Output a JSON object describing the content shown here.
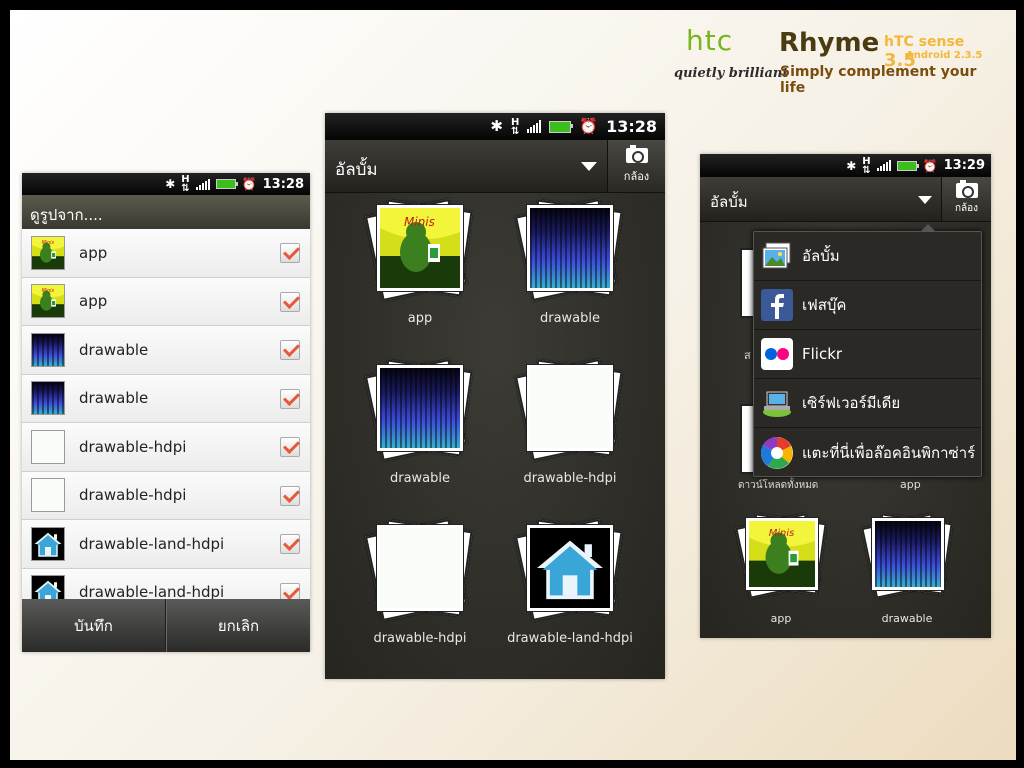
{
  "brand": {
    "logo": "htc",
    "model": "Rhyme",
    "sense": "hTC sense",
    "sense_version": "3.5",
    "android": "Android 2.3.5",
    "tagline1": "quietly brilliant",
    "tagline2": "Simply complement your life"
  },
  "status": {
    "time1": "13:28",
    "time2": "13:28",
    "time3": "13:29",
    "network": "H"
  },
  "phone1": {
    "title": "ดูรูปจาก....",
    "items": [
      {
        "label": "app",
        "art": "app"
      },
      {
        "label": "app",
        "art": "app"
      },
      {
        "label": "drawable",
        "art": "spec"
      },
      {
        "label": "drawable",
        "art": "spec"
      },
      {
        "label": "drawable-hdpi",
        "art": "blank"
      },
      {
        "label": "drawable-hdpi",
        "art": "blank"
      },
      {
        "label": "drawable-land-hdpi",
        "art": "house"
      },
      {
        "label": "drawable-land-hdpi",
        "art": "house"
      }
    ],
    "save": "บันทึก",
    "cancel": "ยกเลิก"
  },
  "phone2": {
    "title": "อัลบั้ม",
    "camera": "กล้อง",
    "items": [
      {
        "label": "app",
        "art": "app"
      },
      {
        "label": "drawable",
        "art": "spec"
      },
      {
        "label": "drawable",
        "art": "spec"
      },
      {
        "label": "drawable-hdpi",
        "art": "blank"
      },
      {
        "label": "drawable-hdpi",
        "art": "blank"
      },
      {
        "label": "drawable-land-hdpi",
        "art": "house"
      }
    ]
  },
  "phone3": {
    "title": "อัลบั้ม",
    "camera": "กล้อง",
    "menu": [
      {
        "label": "อัลบั้ม",
        "icon": "album-icon"
      },
      {
        "label": "เฟสบุ๊ค",
        "icon": "facebook-icon"
      },
      {
        "label": "Flickr",
        "icon": "flickr-icon"
      },
      {
        "label": "เซิร์ฟเวอร์มีเดีย",
        "icon": "media-server-icon"
      },
      {
        "label": "แตะที่นี่เพื่อล๊อคอินพิกาซ่าร์",
        "icon": "picasa-icon"
      }
    ],
    "behind": {
      "left_label": "ดาวน์โหลดทั้งหมด",
      "right_label": "app",
      "partial": "ส"
    },
    "items": [
      {
        "label": "app",
        "art": "app"
      },
      {
        "label": "drawable",
        "art": "spec"
      }
    ]
  },
  "colors": {
    "checkmark": "#e45a3a",
    "battery": "#3cbf1d",
    "brand_green": "#79b51c"
  }
}
